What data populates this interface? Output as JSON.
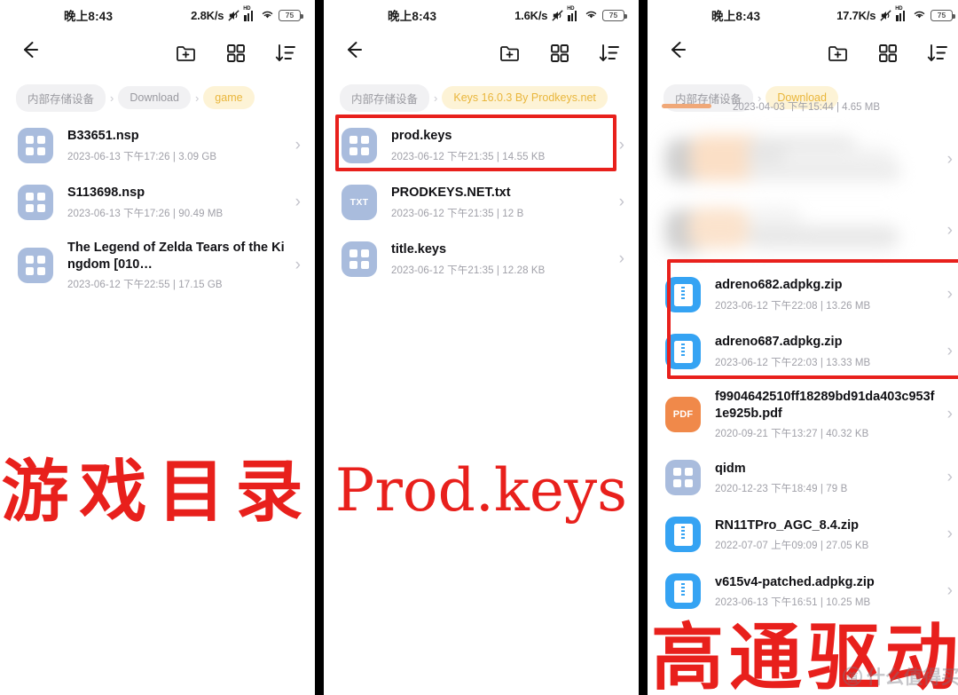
{
  "panels": [
    {
      "status": {
        "time": "晚上8:43",
        "speed": "2.8K/s",
        "battery": "75",
        "hd": "HD"
      },
      "toolbar": {
        "back": "back-arrow",
        "new_folder": "new-folder",
        "grid": "grid-view",
        "sort": "sort"
      },
      "breadcrumb": [
        {
          "label": "内部存储设备",
          "active": false
        },
        {
          "label": "Download",
          "active": false
        },
        {
          "label": "game",
          "active": true
        }
      ],
      "files": [
        {
          "name": "B33651.nsp",
          "date": "2023-06-13 下午17:26",
          "size": "3.09 GB",
          "icon": "folder"
        },
        {
          "name": "S113698.nsp",
          "date": "2023-06-13 下午17:26",
          "size": "90.49 MB",
          "icon": "folder"
        },
        {
          "name": "The Legend of Zelda Tears of the Kingdom [010…",
          "date": "2023-06-12 下午22:55",
          "size": "17.15 GB",
          "icon": "folder"
        }
      ],
      "caption": "游戏目录",
      "caption_style": "cn"
    },
    {
      "status": {
        "time": "晚上8:43",
        "speed": "1.6K/s",
        "battery": "75",
        "hd": "HD"
      },
      "toolbar": {
        "back": "back-arrow",
        "new_folder": "new-folder",
        "grid": "grid-view",
        "sort": "sort"
      },
      "breadcrumb": [
        {
          "label": "内部存储设备",
          "active": false
        },
        {
          "label": "Keys 16.0.3 By Prodkeys.net",
          "active": true
        }
      ],
      "files": [
        {
          "name": "prod.keys",
          "date": "2023-06-12 下午21:35",
          "size": "14.55 KB",
          "icon": "folder",
          "highlight": true
        },
        {
          "name": "PRODKEYS.NET.txt",
          "date": "2023-06-12 下午21:35",
          "size": "12 B",
          "icon": "txt"
        },
        {
          "name": "title.keys",
          "date": "2023-06-12 下午21:35",
          "size": "12.28 KB",
          "icon": "folder"
        }
      ],
      "caption": "Prod.keys",
      "caption_style": "en"
    },
    {
      "status": {
        "time": "晚上8:43",
        "speed": "17.7K/s",
        "battery": "75",
        "hd": "HD"
      },
      "toolbar": {
        "back": "back-arrow",
        "new_folder": "new-folder",
        "grid": "grid-view",
        "sort": "sort"
      },
      "breadcrumb": [
        {
          "label": "内部存储设备",
          "active": false
        },
        {
          "label": "Download",
          "active": true
        }
      ],
      "scrolled_meta": "2023-04-03 下午15:44 | 4.65 MB",
      "files": [
        {
          "name": "",
          "date": "",
          "size": "",
          "icon": "blurred"
        },
        {
          "name": "",
          "date": "",
          "size": "",
          "icon": "blurred"
        },
        {
          "name": "adreno682.adpkg.zip",
          "date": "2023-06-12 下午22:08",
          "size": "13.26 MB",
          "icon": "zip",
          "highlight": true
        },
        {
          "name": "adreno687.adpkg.zip",
          "date": "2023-06-12 下午22:03",
          "size": "13.33 MB",
          "icon": "zip",
          "highlight": true
        },
        {
          "name": "f9904642510ff18289bd91da403c953f1e925b.pdf",
          "date": "2020-09-21 下午13:27",
          "size": "40.32 KB",
          "icon": "pdf"
        },
        {
          "name": "qidm",
          "date": "2020-12-23 下午18:49",
          "size": "79 B",
          "icon": "folder"
        },
        {
          "name": "RN11TPro_AGC_8.4.zip",
          "date": "2022-07-07 上午09:09",
          "size": "27.05 KB",
          "icon": "zip"
        },
        {
          "name": "v615v4-patched.adpkg.zip",
          "date": "2023-06-13 下午16:51",
          "size": "10.25 MB",
          "icon": "zip"
        }
      ],
      "caption": "高通驱动",
      "caption_style": "cn"
    }
  ],
  "watermark": {
    "text": "什么值得买",
    "mark": "值"
  },
  "colors": {
    "accent": "#e8b63c",
    "highlight": "#e8201c",
    "zip": "#35a3f3",
    "pdf": "#f0894a",
    "folder": "#a9bcdd"
  }
}
